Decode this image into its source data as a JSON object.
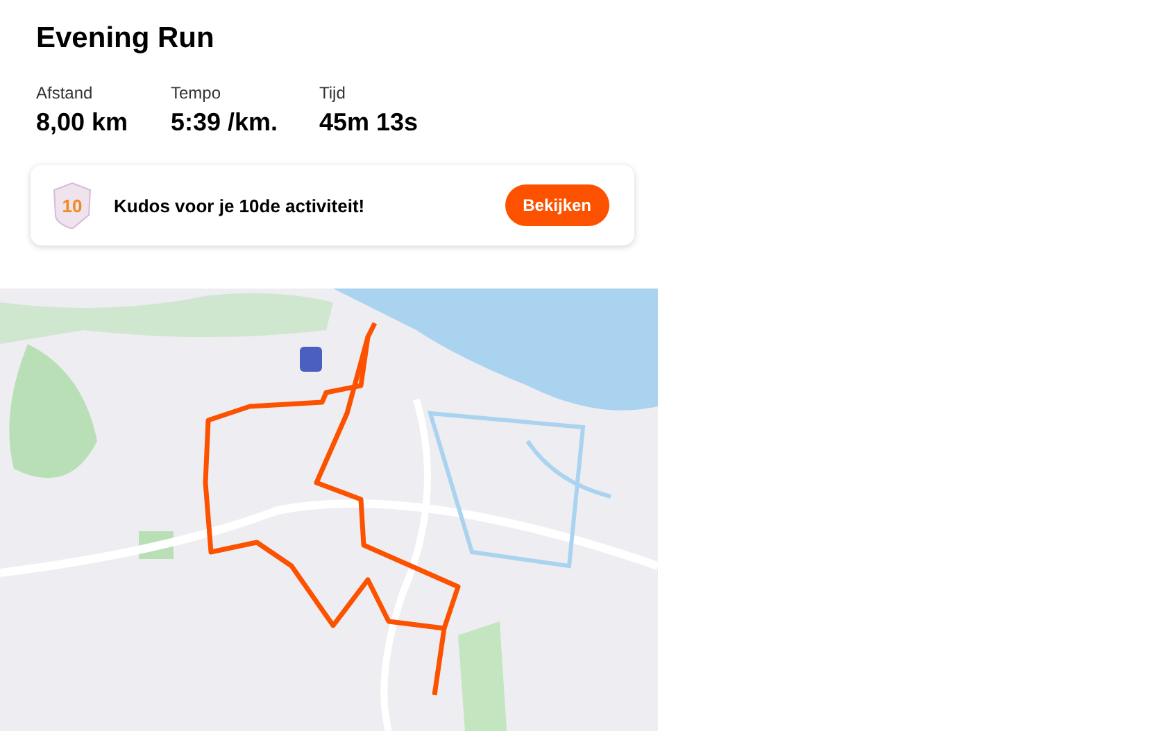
{
  "activity": {
    "title": "Evening Run"
  },
  "stats": [
    {
      "label": "Afstand",
      "value": "8,00 km"
    },
    {
      "label": "Tempo",
      "value": "5:39 /km."
    },
    {
      "label": "Tijd",
      "value": "45m 13s"
    }
  ],
  "kudos": {
    "badge": "10",
    "message": "Kudos voor je 10de activiteit!",
    "button": "Bekijken"
  }
}
